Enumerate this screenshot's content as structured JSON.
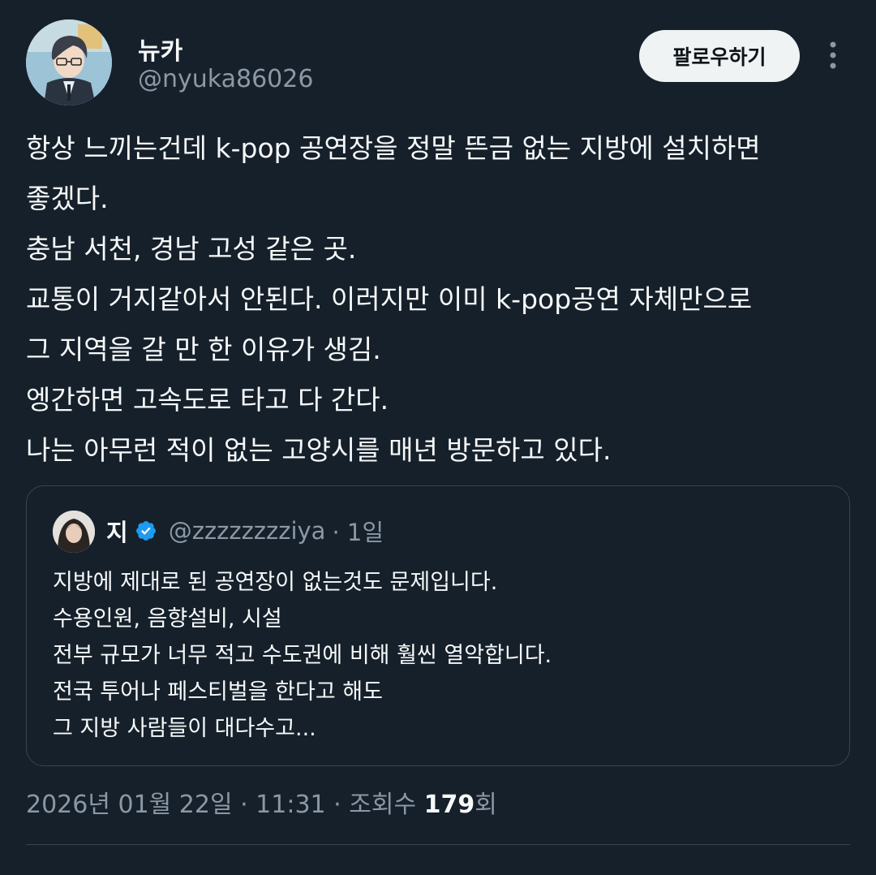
{
  "author": {
    "display_name": "뉴카",
    "handle": "@nyuka86026"
  },
  "actions": {
    "follow_label": "팔로우하기",
    "more_icon": "more-vertical-icon"
  },
  "tweet": {
    "lines": [
      "항상 느끼는건데 k-pop 공연장을 정말 뜬금 없는 지방에 설치하면",
      "좋겠다.",
      "충남 서천, 경남 고성 같은 곳.",
      "교통이 거지같아서 안된다. 이러지만 이미 k-pop공연 자체만으로",
      "그 지역을 갈 만 한 이유가 생김.",
      "엥간하면 고속도로 타고 다 간다.",
      "나는 아무런 적이 없는 고양시를 매년 방문하고 있다."
    ]
  },
  "quote": {
    "display_name": "지",
    "verified_icon": "verified-badge-icon",
    "handle": "@zzzzzzzziya",
    "time": "· 1일",
    "lines": [
      "지방에 제대로 된 공연장이 없는것도 문제입니다.",
      "수용인원, 음향설비, 시설",
      "전부 규모가 너무 적고 수도권에 비해 훨씬 열악합니다.",
      "전국 투어나 페스티벌을 한다고 해도",
      "그 지방 사람들이 대다수고..."
    ]
  },
  "meta": {
    "timestamp": "2026년 01월 22일 · 11:31 · 조회수 ",
    "views": "179",
    "views_suffix": "회"
  },
  "colors": {
    "background": "#15202b",
    "text": "#f7f9f9",
    "secondary": "#8b98a5",
    "border": "#38444d",
    "verified": "#1d9bf0"
  }
}
